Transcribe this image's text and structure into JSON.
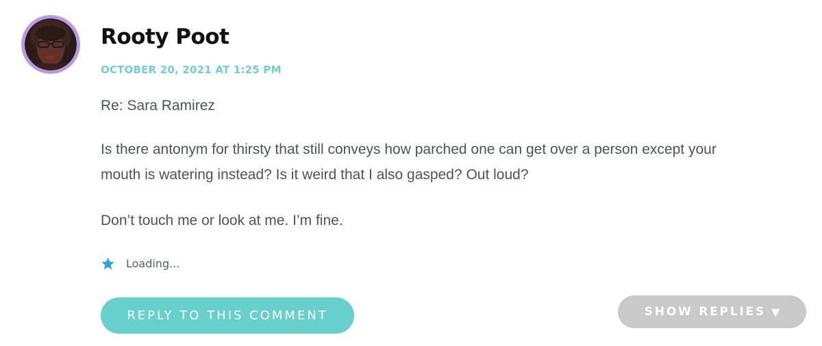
{
  "comment": {
    "author": "Rooty Poot",
    "timestamp": "OCTOBER 20, 2021 AT 1:25 PM",
    "paragraphs": [
      "Re: Sara Ramirez",
      "Is there antonym for thirsty that still conveys how parched one can get over a person except your",
      "mouth is watering instead? Is it weird that I also gasped? Out loud?",
      "Don’t touch me or look at me. I’m fine."
    ],
    "like_status": "Loading...",
    "like_icon": "star-icon",
    "avatar_icon": "user-avatar"
  },
  "actions": {
    "reply_label": "REPLY TO THIS COMMENT",
    "show_replies_label": "SHOW REPLIES",
    "show_replies_icon": "▼"
  },
  "colors": {
    "avatar_ring": "#b69ae6",
    "timestamp": "#6fcfd6",
    "star": "#2ea3dd",
    "reply_button": "#67cfcc",
    "show_replies_button": "#c9c9c9",
    "body_text": "#4b5456",
    "author_text": "#111111"
  }
}
